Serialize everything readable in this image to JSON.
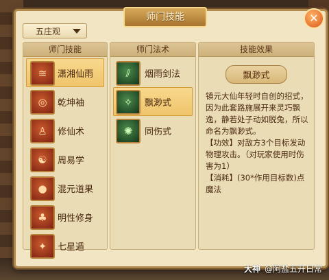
{
  "window": {
    "title": "师门技能"
  },
  "close_icon": "close-icon",
  "school_select": {
    "value": "五庄观"
  },
  "headers": {
    "skills": "师门技能",
    "spells": "师门法术",
    "effect": "技能效果"
  },
  "skills": [
    {
      "label": "潇湘仙雨",
      "icon": "water-swirl-icon",
      "selected": true
    },
    {
      "label": "乾坤袖",
      "icon": "sleeve-swirl-icon",
      "selected": false
    },
    {
      "label": "修仙术",
      "icon": "figure-icon",
      "selected": false
    },
    {
      "label": "周易学",
      "icon": "yinyang-icon",
      "selected": false
    },
    {
      "label": "混元道果",
      "icon": "orb-icon",
      "selected": false
    },
    {
      "label": "明性修身",
      "icon": "meditate-icon",
      "selected": false
    },
    {
      "label": "七星遁",
      "icon": "stars-icon",
      "selected": false
    }
  ],
  "spells": [
    {
      "label": "烟雨剑法",
      "icon": "sword-rain-icon",
      "selected": false
    },
    {
      "label": "飘渺式",
      "icon": "whirl-icon",
      "selected": true
    },
    {
      "label": "同伤式",
      "icon": "shared-wound-icon",
      "selected": false
    }
  ],
  "effect": {
    "name": "飘渺式",
    "lines": [
      "镇元大仙年轻时自创的招式，因为此套路施展开来灵巧飘逸，静若处子动如脱兔，所以命名为飘渺式。",
      "【功效】对敌方3个目标发动物理攻击。（对玩家使用时伤害为1）",
      "【消耗】(30*作用目标数)点魔法"
    ]
  },
  "watermark": {
    "brand": "大神",
    "text": "@阿盐五开日常"
  }
}
